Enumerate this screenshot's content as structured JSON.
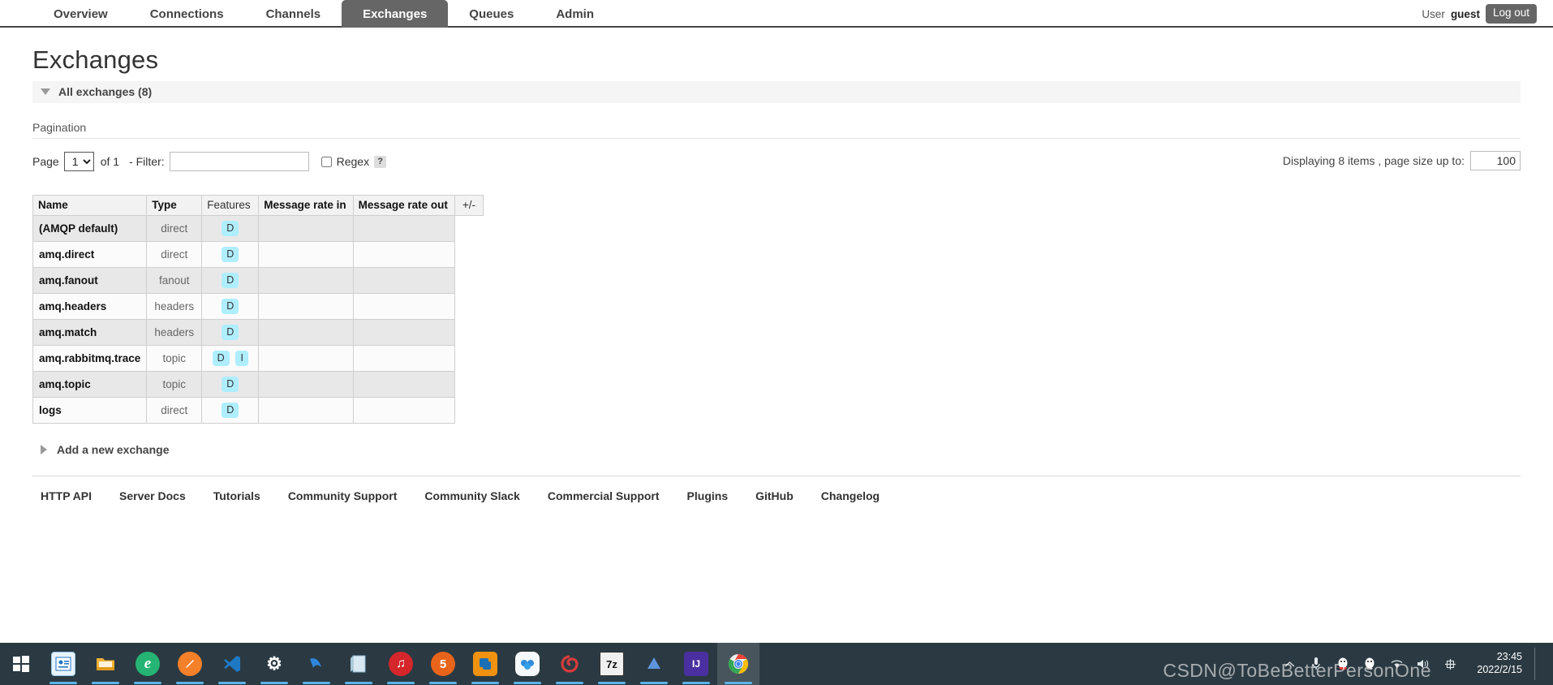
{
  "nav": {
    "tabs": [
      {
        "label": "Overview",
        "active": false
      },
      {
        "label": "Connections",
        "active": false
      },
      {
        "label": "Channels",
        "active": false
      },
      {
        "label": "Exchanges",
        "active": true
      },
      {
        "label": "Queues",
        "active": false
      },
      {
        "label": "Admin",
        "active": false
      }
    ],
    "user_label": "User",
    "user_name": "guest",
    "logout_label": "Log out"
  },
  "page": {
    "title": "Exchanges",
    "section_header": "All exchanges (8)"
  },
  "pagination": {
    "legend": "Pagination",
    "page_label": "Page",
    "page_value": "1",
    "page_options": [
      "1"
    ],
    "of_text": "of 1",
    "filter_label": "- Filter:",
    "filter_value": "",
    "regex_label": "Regex",
    "regex_checked": false,
    "help_glyph": "?",
    "displaying_text": "Displaying 8 items , page size up to:",
    "page_size_value": "100"
  },
  "table": {
    "columns": [
      "Name",
      "Type",
      "Features",
      "Message rate in",
      "Message rate out"
    ],
    "plus_minus": "+/-",
    "rows": [
      {
        "name": "(AMQP default)",
        "type": "direct",
        "features": [
          "D"
        ],
        "rate_in": "",
        "rate_out": ""
      },
      {
        "name": "amq.direct",
        "type": "direct",
        "features": [
          "D"
        ],
        "rate_in": "",
        "rate_out": ""
      },
      {
        "name": "amq.fanout",
        "type": "fanout",
        "features": [
          "D"
        ],
        "rate_in": "",
        "rate_out": ""
      },
      {
        "name": "amq.headers",
        "type": "headers",
        "features": [
          "D"
        ],
        "rate_in": "",
        "rate_out": ""
      },
      {
        "name": "amq.match",
        "type": "headers",
        "features": [
          "D"
        ],
        "rate_in": "",
        "rate_out": ""
      },
      {
        "name": "amq.rabbitmq.trace",
        "type": "topic",
        "features": [
          "D",
          "I"
        ],
        "rate_in": "",
        "rate_out": ""
      },
      {
        "name": "amq.topic",
        "type": "topic",
        "features": [
          "D"
        ],
        "rate_in": "",
        "rate_out": ""
      },
      {
        "name": "logs",
        "type": "direct",
        "features": [
          "D"
        ],
        "rate_in": "",
        "rate_out": ""
      }
    ]
  },
  "add_exchange": {
    "label": "Add a new exchange"
  },
  "footer": {
    "links": [
      "HTTP API",
      "Server Docs",
      "Tutorials",
      "Community Support",
      "Community Slack",
      "Commercial Support",
      "Plugins",
      "GitHub",
      "Changelog"
    ]
  },
  "taskbar": {
    "items": [
      {
        "name": "start-button",
        "glyph": "⊞",
        "bg": "transparent",
        "fg": "#ffffff",
        "running": false
      },
      {
        "name": "contacts-app",
        "glyph": "▤",
        "bg": "#1b7fd4",
        "fg": "#ffffff",
        "running": true
      },
      {
        "name": "file-explorer",
        "glyph": "▒",
        "bg": "#f7b733",
        "fg": "#8a5a00",
        "running": true
      },
      {
        "name": "edge-browser",
        "glyph": "e",
        "bg": "#2bb673",
        "fg": "#ffffff",
        "running": true
      },
      {
        "name": "pen-app",
        "glyph": "✒",
        "bg": "#f47b30",
        "fg": "#ffffff",
        "running": true
      },
      {
        "name": "vs-code",
        "glyph": "✖",
        "bg": "#0a66c2",
        "fg": "#ffffff",
        "running": true
      },
      {
        "name": "settings-app",
        "glyph": "⚙",
        "bg": "transparent",
        "fg": "#ffffff",
        "running": true
      },
      {
        "name": "navicat-app",
        "glyph": "➤",
        "bg": "transparent",
        "fg": "#3b8ede",
        "running": true
      },
      {
        "name": "notepad-app",
        "glyph": "▧",
        "bg": "transparent",
        "fg": "#cfe6f5",
        "running": true
      },
      {
        "name": "netease-music",
        "glyph": "♫",
        "bg": "#d4262b",
        "fg": "#ffffff",
        "running": true
      },
      {
        "name": "html5-app",
        "glyph": "5",
        "bg": "#e8641a",
        "fg": "#ffffff",
        "running": true
      },
      {
        "name": "vmware-app",
        "glyph": "❐",
        "bg": "#f0920f",
        "fg": "#1b6fb5",
        "running": true
      },
      {
        "name": "baidu-netdisk",
        "glyph": "●",
        "bg": "#f2f6f8",
        "fg": "#2f8ddd",
        "running": true
      },
      {
        "name": "wps-app",
        "glyph": "◔",
        "bg": "#d93b3b",
        "fg": "#ffffff",
        "running": true
      },
      {
        "name": "7zip-app",
        "glyph": "7z",
        "bg": "#f0f0f0",
        "fg": "#222222",
        "running": true
      },
      {
        "name": "typora-app",
        "glyph": "▲",
        "bg": "#4f8ad8",
        "fg": "#ffffff",
        "running": true
      },
      {
        "name": "idea-app",
        "glyph": "IJ",
        "bg": "#8a2be2",
        "fg": "#ffffff",
        "running": true
      },
      {
        "name": "chrome-browser",
        "glyph": "◉",
        "bg": "#f2f2f2",
        "fg": "#1a73e8",
        "running": true
      }
    ],
    "tray": {
      "chevron": "⌃",
      "mic": "Ἲ4",
      "qq1": "ὂ7",
      "qq2": "ὂ7",
      "wifi": "◠",
      "volume": "ὐA",
      "ime": "⊞"
    },
    "clock_time": "23:45",
    "clock_date": "2022/2/15",
    "watermark": "CSDN@ToBeBetterPersonOne"
  }
}
